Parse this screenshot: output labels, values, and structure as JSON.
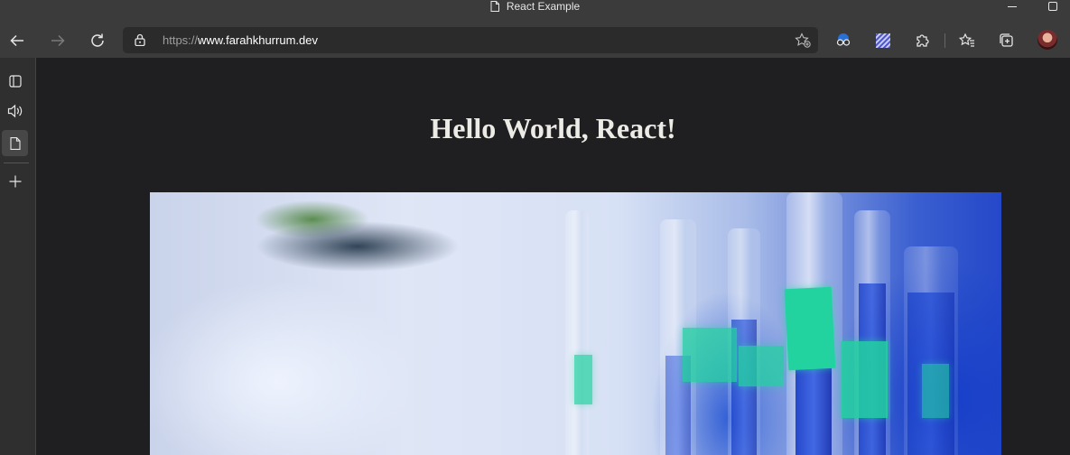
{
  "window": {
    "title": "React Example",
    "doc_icon": "document-icon",
    "controls": {
      "minimize": "minimize-icon",
      "maximize": "maximize-icon"
    }
  },
  "toolbar": {
    "back_icon": "back-arrow-icon",
    "forward_icon": "forward-arrow-icon",
    "refresh_icon": "refresh-icon",
    "address": {
      "lock_icon": "lock-icon",
      "scheme": "https://",
      "host": "www.farahkhurrum.dev",
      "favorite_icon": "add-favorite-icon"
    },
    "extensions": [
      "extension-glasses-icon",
      "extension-pattern-icon",
      "extensions-puzzle-icon"
    ],
    "favorites_icon": "favorites-icon",
    "collections_icon": "collections-icon",
    "profile_icon": "profile-avatar"
  },
  "sidebar": {
    "items": [
      {
        "name": "tab-actions-icon",
        "active": false
      },
      {
        "name": "speaker-icon",
        "active": false
      },
      {
        "name": "document-icon",
        "active": true
      },
      {
        "name": "add-icon",
        "active": false
      }
    ]
  },
  "page": {
    "heading": "Hello World, React!",
    "hero_image": "lab-test-tubes-photo"
  },
  "colors": {
    "chrome": "#3b3b3b",
    "sidebar": "#2f2f2f",
    "page_bg": "#1f1f21",
    "heading": "#ecebe6"
  }
}
